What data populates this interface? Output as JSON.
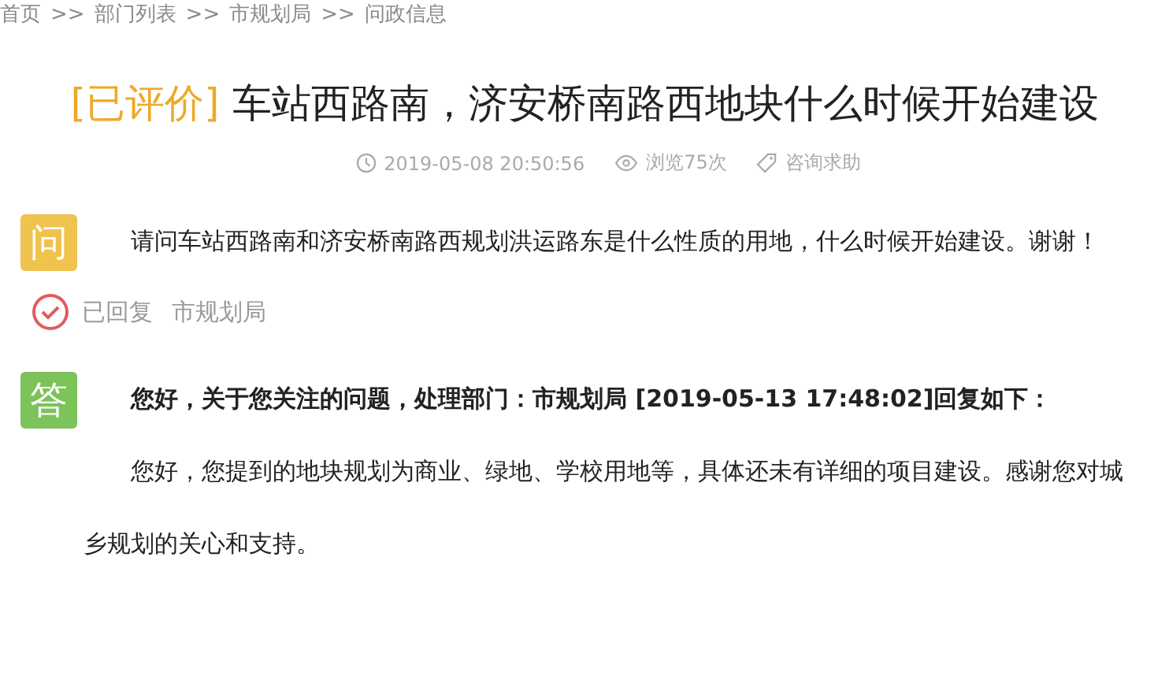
{
  "breadcrumb": {
    "separator": ">>",
    "items": [
      "首页",
      "部门列表",
      "市规划局",
      "问政信息"
    ]
  },
  "title": {
    "status": "[已评价]",
    "text": "车站西路南，济安桥南路西地块什么时候开始建设"
  },
  "meta": {
    "time": "2019-05-08 20:50:56",
    "views": "浏览75次",
    "category": "咨询求助"
  },
  "question": {
    "badge": "问",
    "text": "请问车站西路南和济安桥南路西规划洪运路东是什么性质的用地，什么时候开始建设。谢谢！"
  },
  "reply_status": {
    "replied": true,
    "label": "已回复",
    "department": "市规划局"
  },
  "answer": {
    "badge": "答",
    "header": "您好，关于您关注的问题，处理部门：市规划局 [2019-05-13 17:48:02]回复如下：",
    "text": "您好，您提到的地块规划为商业、绿地、学校用地等，具体还未有详细的项目建设。感谢您对城乡规划的关心和支持。"
  }
}
